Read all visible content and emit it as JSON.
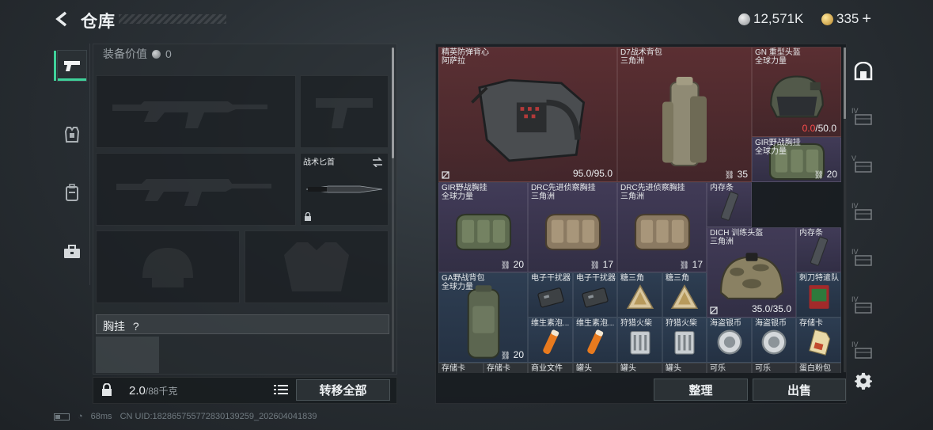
{
  "header": {
    "title": "仓库",
    "silver_amount": "12,571K",
    "gold_amount": "335",
    "plus": "+"
  },
  "nav": {
    "items": [
      "weapons-tab",
      "equipment-tab",
      "backpack-tab",
      "toolbox-tab"
    ],
    "active": "weapons-tab"
  },
  "equipment": {
    "value_label": "装备价值",
    "value_amount": "0",
    "knife_slot_label": "战术匕首",
    "chest_label": "胸挂",
    "chest_help": "?"
  },
  "footer_bar": {
    "weight_current": "2.0",
    "weight_max": "/88千克",
    "transfer_all": "转移全部"
  },
  "inventory": {
    "cells": [
      {
        "name1": "精英防弹背心",
        "name2": "阿萨拉",
        "dur_a": "95.0",
        "dur_b": "/95.0",
        "bg": "red",
        "art": "vest"
      },
      {
        "name1": "D7战术背包",
        "name2": "三角洲",
        "count": "35",
        "bg": "red",
        "art": "backpack-tall"
      },
      {
        "name1": "GN 重型头盔",
        "name2": "全球力量",
        "dur_a": "0.0",
        "dur_b": "/50.0",
        "bg": "red",
        "art": "helmet-heavy"
      },
      {
        "name1": "GIR野战胸挂",
        "name2": "全球力量",
        "count": "20",
        "bg": "purple",
        "art": "rig-green"
      },
      {
        "name1": "GIR野战胸挂",
        "name2": "全球力量",
        "count": "20",
        "bg": "purple",
        "art": "rig-green"
      },
      {
        "name1": "DRC先进侦察胸挂",
        "name2": "三角洲",
        "count": "17",
        "bg": "purple",
        "art": "rig-tan"
      },
      {
        "name1": "DRC先进侦察胸挂",
        "name2": "三角洲",
        "count": "17",
        "bg": "purple",
        "art": "rig-tan"
      },
      {
        "name1": "内存条",
        "name2": "",
        "bg": "purple",
        "art": "ram"
      },
      {
        "name1": "DICH 训练头盔",
        "name2": "三角洲",
        "dur_a": "35.0",
        "dur_b": "/35.0",
        "bg": "purple",
        "art": "helmet-camo"
      },
      {
        "name1": "内存条",
        "name2": "",
        "bg": "purple",
        "art": "ram"
      },
      {
        "name1": "GA野战背包",
        "name2": "全球力量",
        "count": "20",
        "bg": "blue",
        "art": "backpack-green"
      },
      {
        "name1": "电子干扰器",
        "name2": "",
        "bg": "blue",
        "art": "jammer"
      },
      {
        "name1": "电子干扰器",
        "name2": "",
        "bg": "blue",
        "art": "jammer"
      },
      {
        "name1": "糖三角",
        "name2": "",
        "bg": "blue",
        "art": "triangle"
      },
      {
        "name1": "糖三角",
        "name2": "",
        "bg": "blue",
        "art": "triangle"
      },
      {
        "name1": "刺刀特遣队",
        "name2": "",
        "bg": "blue",
        "art": "card-red"
      },
      {
        "name1": "维生素泡...",
        "name2": "",
        "bg": "blue",
        "art": "tube"
      },
      {
        "name1": "维生素泡...",
        "name2": "",
        "bg": "blue",
        "art": "tube"
      },
      {
        "name1": "狩猎火柴",
        "name2": "",
        "bg": "blue",
        "art": "matches"
      },
      {
        "name1": "狩猎火柴",
        "name2": "",
        "bg": "blue",
        "art": "matches"
      },
      {
        "name1": "海盗银币",
        "name2": "",
        "bg": "blue",
        "art": "coin"
      },
      {
        "name1": "海盗银币",
        "name2": "",
        "bg": "blue",
        "art": "coin"
      },
      {
        "name1": "存储卡",
        "name2": "",
        "bg": "blue",
        "art": "sdcard"
      },
      {
        "name1": "存储卡",
        "name2": "",
        "bg": "grey",
        "art": "none"
      },
      {
        "name1": "存储卡",
        "name2": "",
        "bg": "grey",
        "art": "none"
      },
      {
        "name1": "商业文件",
        "name2": "",
        "bg": "grey",
        "art": "none"
      },
      {
        "name1": "罐头",
        "name2": "",
        "bg": "grey",
        "art": "none"
      },
      {
        "name1": "罐头",
        "name2": "",
        "bg": "grey",
        "art": "none"
      },
      {
        "name1": "罐头",
        "name2": "",
        "bg": "grey",
        "art": "none"
      },
      {
        "name1": "可乐",
        "name2": "",
        "bg": "grey",
        "art": "none"
      },
      {
        "name1": "可乐",
        "name2": "",
        "bg": "grey",
        "art": "none"
      },
      {
        "name1": "蛋白粉包",
        "name2": "",
        "bg": "grey",
        "art": "none"
      }
    ],
    "sort_label": "整理",
    "sell_label": "出售"
  },
  "status": {
    "ping": "68ms",
    "uid": "CN UID:182865755772830139259_202604041839"
  },
  "side_icons": [
    "safe-box-icon",
    "vehicle-icon",
    "camera-case-icon",
    "crate-icon",
    "crate-icon",
    "crate-icon",
    "crate-icon"
  ],
  "side_tiers": [
    "IV",
    "V",
    "IV",
    "IV",
    "IV",
    "IV"
  ],
  "colors": {
    "accent": "#3fd29a",
    "red_tier": "#703437",
    "purple_tier": "#4e4468",
    "blue_tier": "#344862",
    "durability_zero": "#ff4d4d"
  }
}
